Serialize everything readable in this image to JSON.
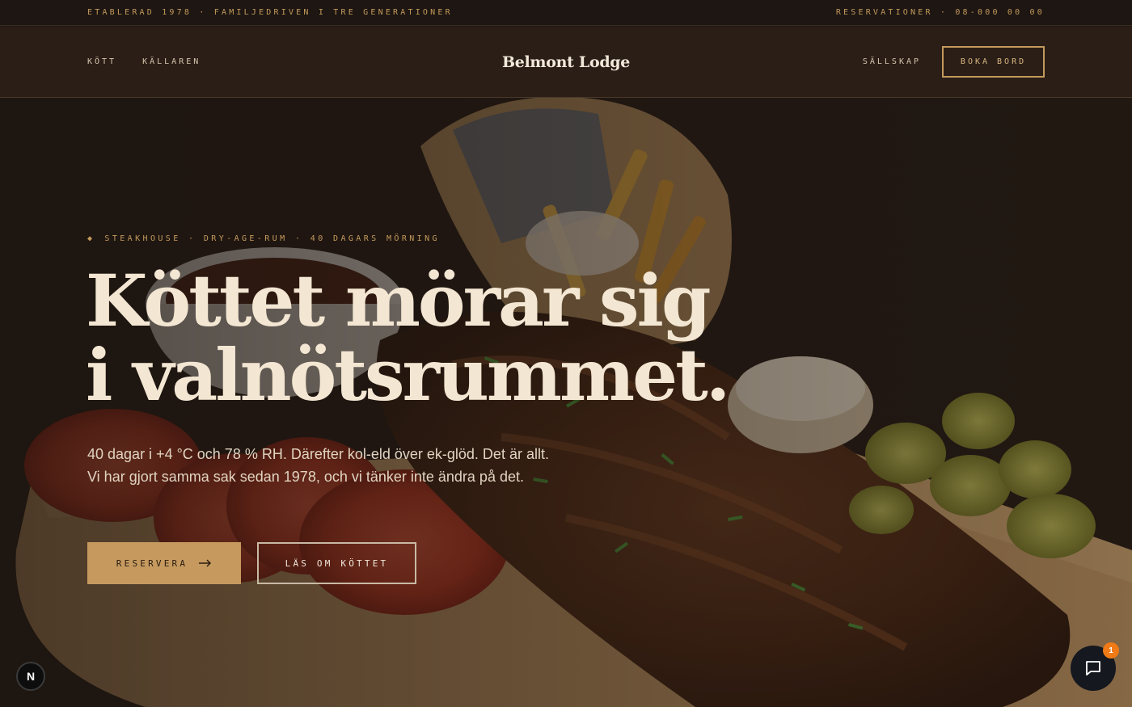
{
  "topbar": {
    "left": "ETABLERAD 1978 · FAMILJEDRIVEN I TRE GENERATIONER",
    "right": "RESERVATIONER · 08-000 00 00"
  },
  "nav": {
    "left_items": [
      "KÖTT",
      "KÄLLAREN"
    ],
    "brand": "Belmont Lodge",
    "right_items": [
      "SÄLLSKAP"
    ],
    "cta": "BOKA BORD"
  },
  "hero": {
    "eyebrow_icon": "diamond-icon",
    "eyebrow": "STEAKHOUSE · DRY-AGE-RUM · 40 DAGARS MÖRNING",
    "headline_line1": "Köttet mörar sig",
    "headline_line2": "i valnötsrummet.",
    "lede": "40 dagar i +4 °C och 78 % RH. Därefter kol-eld över ek-glöd. Det är allt. Vi har gjort samma sak sedan 1978, och vi tänker inte ändra på det.",
    "primary_cta": "RESERVERA",
    "secondary_cta": "LÄS OM KÖTTET"
  },
  "widgets": {
    "dev_badge": "N",
    "chat_badge_count": "1"
  },
  "colors": {
    "accent": "#c69a5f",
    "background": "#2a1e17",
    "text": "#f3e6d2"
  }
}
